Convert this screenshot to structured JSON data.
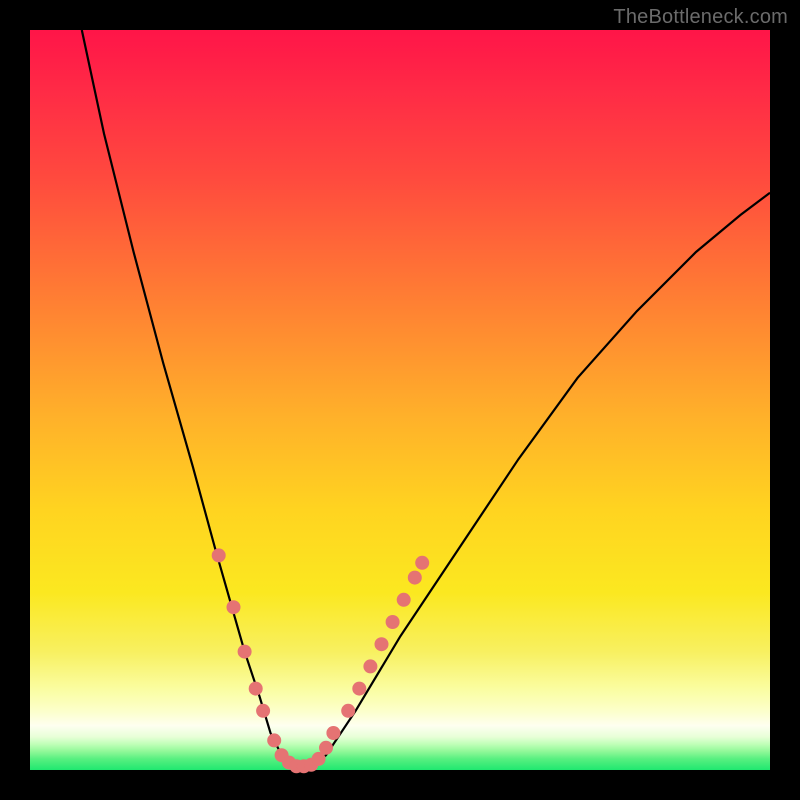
{
  "watermark": "TheBottleneck.com",
  "chart_data": {
    "type": "line",
    "title": "",
    "xlabel": "",
    "ylabel": "",
    "xlim": [
      0,
      100
    ],
    "ylim": [
      0,
      100
    ],
    "grid": false,
    "legend": false,
    "series": [
      {
        "name": "bottleneck-curve",
        "color": "#000000",
        "x": [
          7,
          10,
          14,
          18,
          22,
          25,
          27,
          29,
          31,
          32.5,
          34,
          36,
          38,
          40,
          44,
          50,
          58,
          66,
          74,
          82,
          90,
          96,
          100
        ],
        "y": [
          100,
          86,
          70,
          55,
          41,
          30,
          23,
          16,
          10,
          5,
          2,
          0.5,
          0.5,
          2,
          8,
          18,
          30,
          42,
          53,
          62,
          70,
          75,
          78
        ]
      }
    ],
    "markers": {
      "name": "highlight-dots",
      "color": "#e57373",
      "radius": 7,
      "points": [
        {
          "x": 25.5,
          "y": 29
        },
        {
          "x": 27.5,
          "y": 22
        },
        {
          "x": 29.0,
          "y": 16
        },
        {
          "x": 30.5,
          "y": 11
        },
        {
          "x": 31.5,
          "y": 8
        },
        {
          "x": 33.0,
          "y": 4
        },
        {
          "x": 34.0,
          "y": 2
        },
        {
          "x": 35.0,
          "y": 1
        },
        {
          "x": 36.0,
          "y": 0.5
        },
        {
          "x": 37.0,
          "y": 0.5
        },
        {
          "x": 38.0,
          "y": 0.7
        },
        {
          "x": 39.0,
          "y": 1.5
        },
        {
          "x": 40.0,
          "y": 3
        },
        {
          "x": 41.0,
          "y": 5
        },
        {
          "x": 43.0,
          "y": 8
        },
        {
          "x": 44.5,
          "y": 11
        },
        {
          "x": 46.0,
          "y": 14
        },
        {
          "x": 47.5,
          "y": 17
        },
        {
          "x": 49.0,
          "y": 20
        },
        {
          "x": 50.5,
          "y": 23
        },
        {
          "x": 52.0,
          "y": 26
        },
        {
          "x": 53.0,
          "y": 28
        }
      ]
    },
    "gradient_bands": [
      {
        "pos": 0.0,
        "color": "#ff1548"
      },
      {
        "pos": 0.35,
        "color": "#ff7a34"
      },
      {
        "pos": 0.65,
        "color": "#ffd420"
      },
      {
        "pos": 0.92,
        "color": "#fcffca"
      },
      {
        "pos": 1.0,
        "color": "#20e870"
      }
    ]
  }
}
